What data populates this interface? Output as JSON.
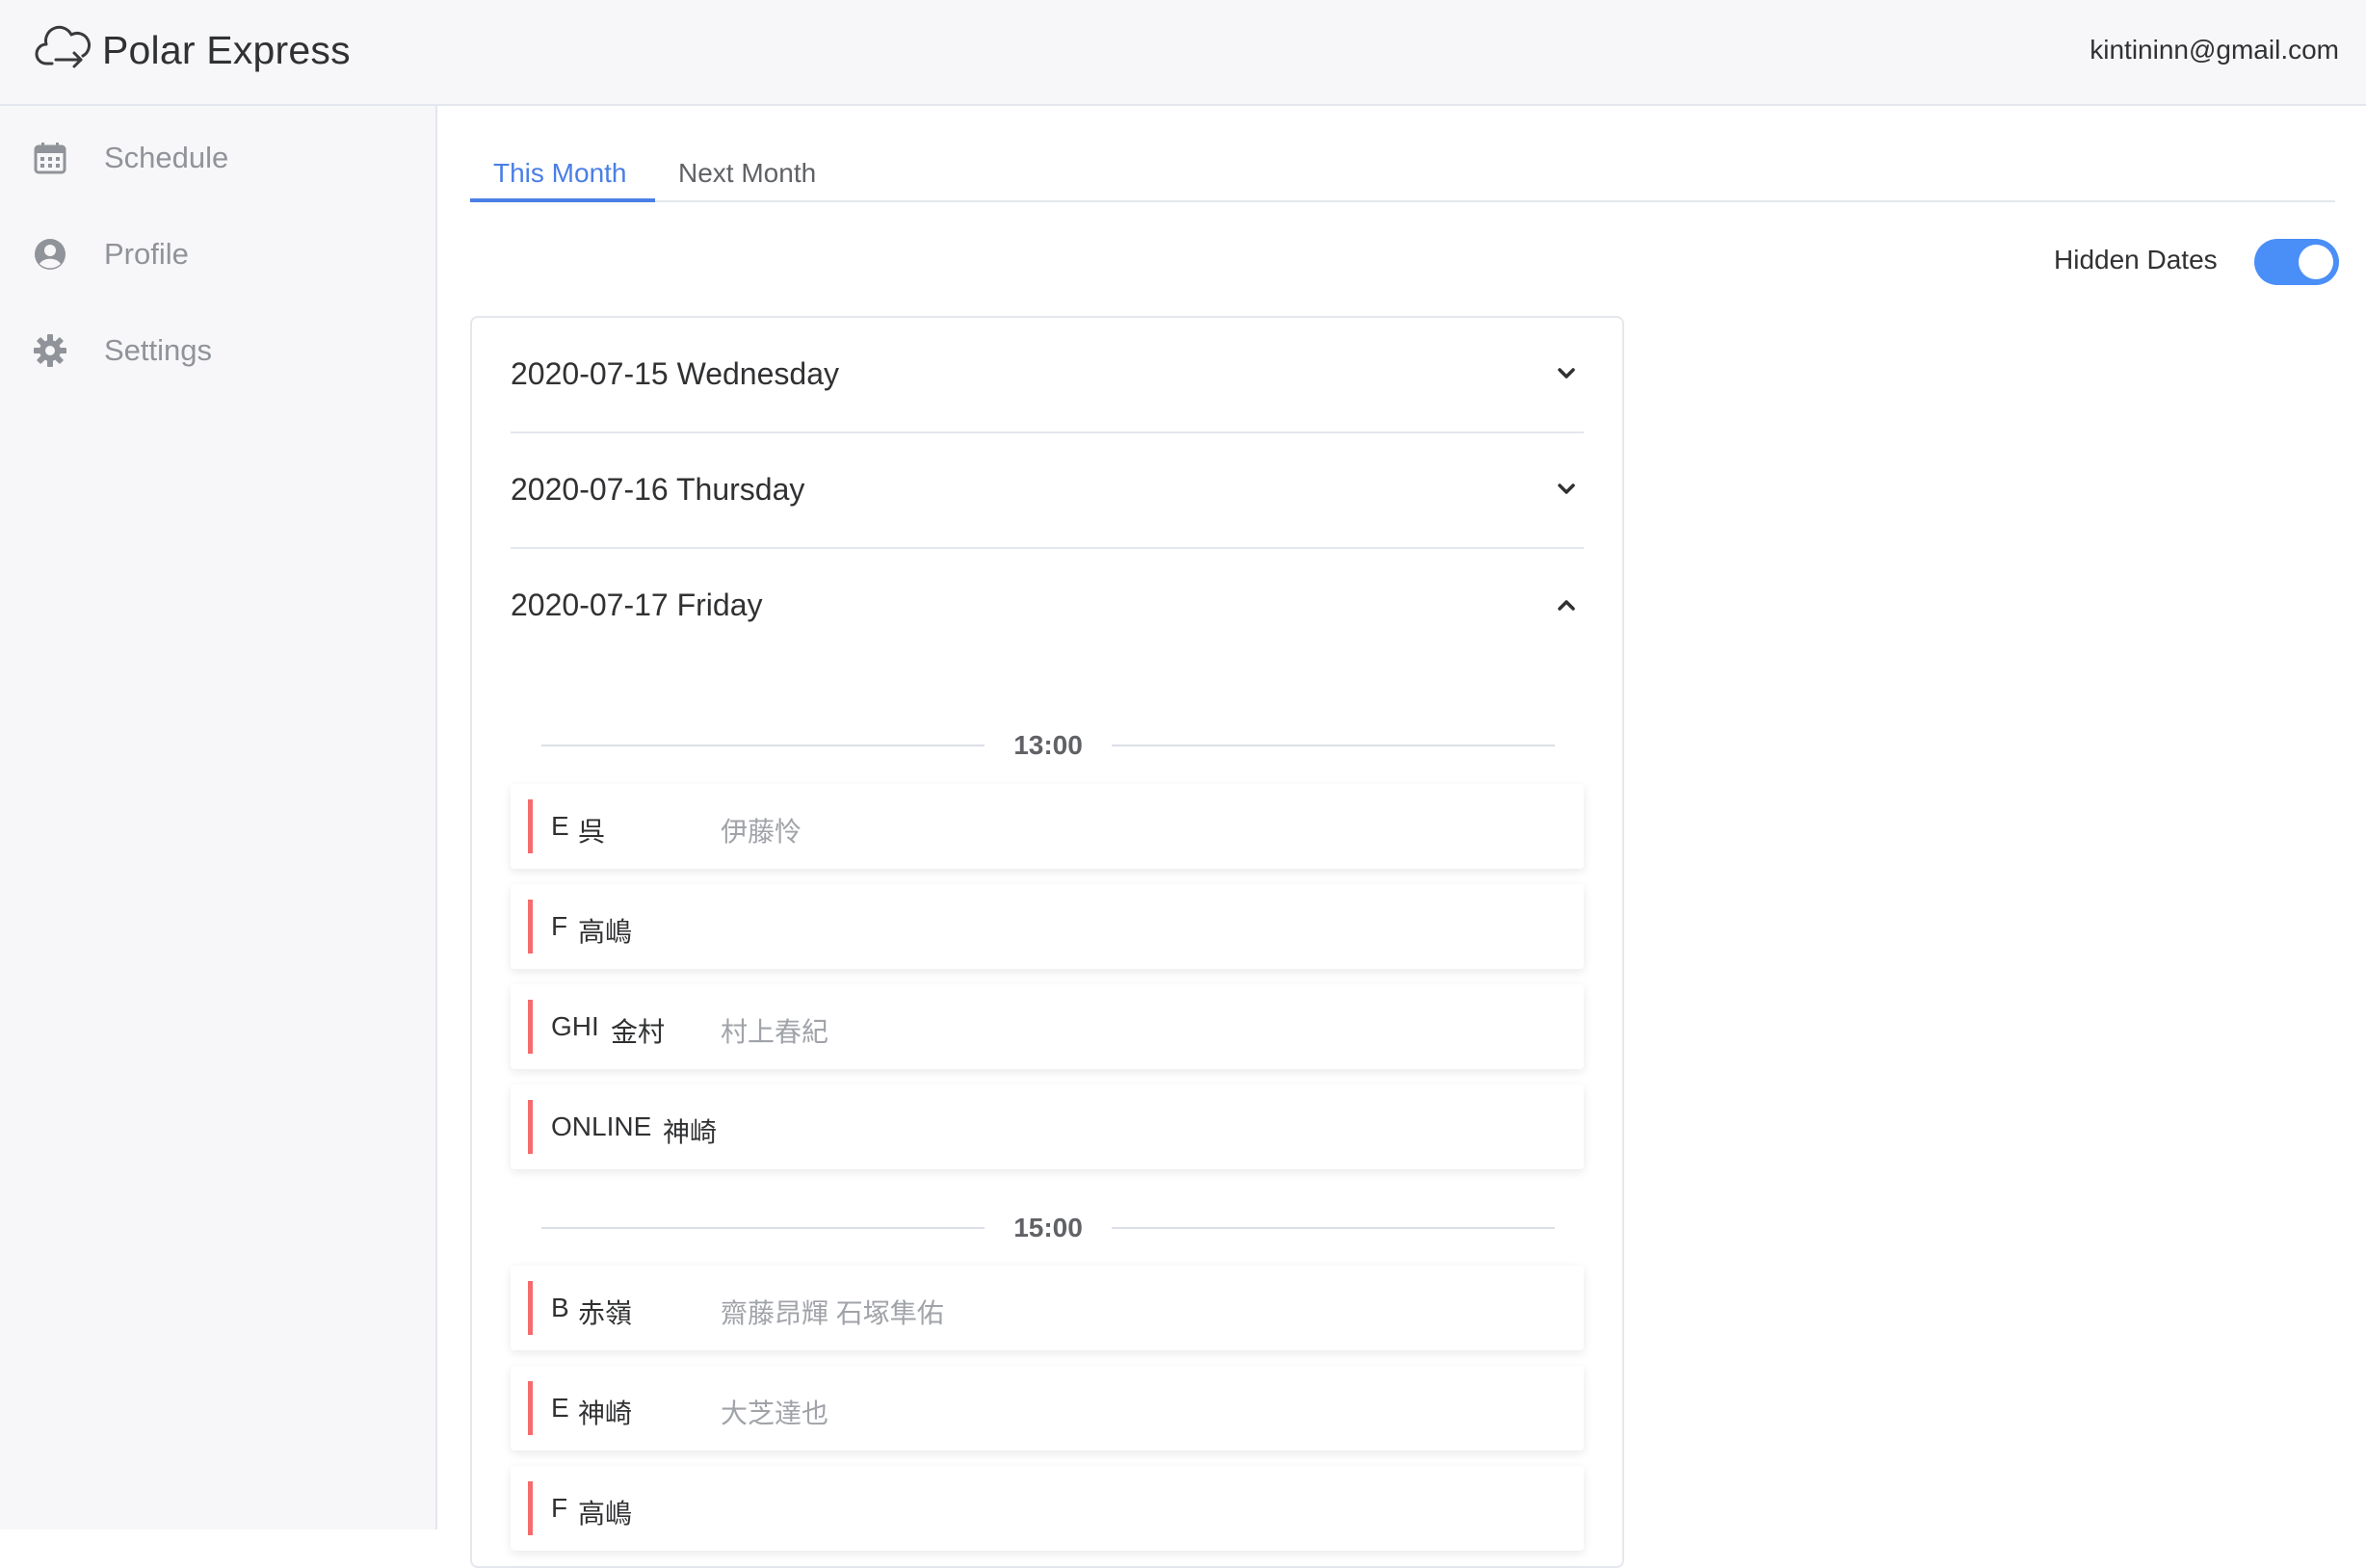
{
  "app": {
    "title": "Polar Express",
    "user_email": "kintininn@gmail.com"
  },
  "sidebar": {
    "items": [
      {
        "label": "Schedule",
        "icon": "calendar-icon"
      },
      {
        "label": "Profile",
        "icon": "user-circle-icon"
      },
      {
        "label": "Settings",
        "icon": "gear-icon"
      }
    ]
  },
  "tabs": [
    {
      "label": "This Month",
      "active": true
    },
    {
      "label": "Next Month",
      "active": false
    }
  ],
  "toggle": {
    "label": "Hidden Dates",
    "on": true
  },
  "colors": {
    "accent": "#4a7ee6",
    "toggle_on": "#4a8ef7",
    "entry_bar": "#f56c6c"
  },
  "dates": [
    {
      "title": "2020-07-15 Wednesday",
      "expanded": false
    },
    {
      "title": "2020-07-16 Thursday",
      "expanded": false
    },
    {
      "title": "2020-07-17 Friday",
      "expanded": true
    }
  ],
  "slots": [
    {
      "time": "13:00",
      "entries": [
        {
          "class": "E",
          "teacher": "呉",
          "students": "伊藤怜"
        },
        {
          "class": "F",
          "teacher": "高嶋",
          "students": ""
        },
        {
          "class": "GHI",
          "teacher": "金村",
          "students": "村上春紀"
        },
        {
          "class": "ONLINE",
          "teacher": "神崎",
          "students": ""
        }
      ]
    },
    {
      "time": "15:00",
      "entries": [
        {
          "class": "B",
          "teacher": "赤嶺",
          "students": "齋藤昂輝 石塚隼佑"
        },
        {
          "class": "E",
          "teacher": "神崎",
          "students": "大芝達也"
        },
        {
          "class": "F",
          "teacher": "高嶋",
          "students": ""
        }
      ]
    }
  ]
}
